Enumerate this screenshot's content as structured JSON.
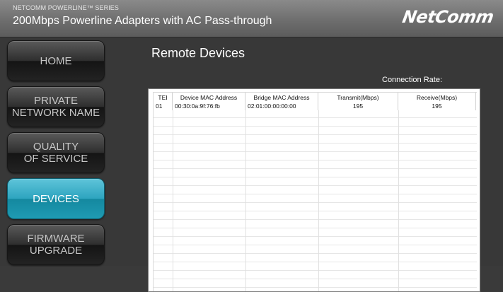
{
  "header": {
    "series": "NETCOMM POWERLINE™ SERIES",
    "product": "200Mbps Powerline Adapters with AC Pass-through",
    "logo": "NetComm"
  },
  "nav": [
    {
      "label": "HOME",
      "active": false
    },
    {
      "label": "PRIVATE\nNETWORK NAME",
      "active": false
    },
    {
      "label": "QUALITY\nOF SERVICE",
      "active": false
    },
    {
      "label": "DEVICES",
      "active": true
    },
    {
      "label": "FIRMWARE\nUPGRADE",
      "active": false
    }
  ],
  "page": {
    "title": "Remote Devices",
    "connection_rate_label": "Connection Rate:"
  },
  "table": {
    "columns": [
      "TEI",
      "Device MAC Address",
      "Bridge MAC Address",
      "Transmit(Mbps)",
      "Receive(Mbps)"
    ],
    "rows": [
      [
        "01",
        "00:30:0a:9f:76:fb",
        "02:01:00:00:00:00",
        "195",
        "195"
      ]
    ]
  },
  "colors": {
    "active_button": "#2da4bf",
    "background": "#383838",
    "header": "#6e6e6e"
  }
}
